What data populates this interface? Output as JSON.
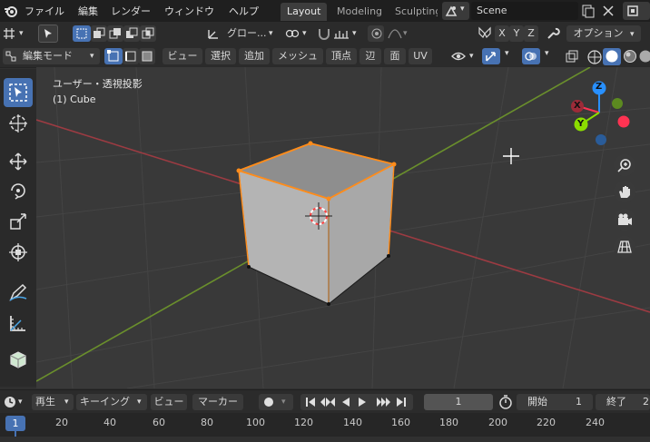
{
  "menubar": {
    "items": [
      "ファイル",
      "編集",
      "レンダー",
      "ウィンドウ",
      "ヘルプ"
    ],
    "workspace_tabs": [
      "Layout",
      "Modeling",
      "Sculpting"
    ],
    "active_tab": "Layout",
    "scene_name": "Scene"
  },
  "header1": {
    "transform_orientation": "グロー...",
    "axis_x": "X",
    "axis_y": "Y",
    "axis_z": "Z",
    "options": "オプション"
  },
  "header2": {
    "mode": "編集モード",
    "menus": [
      "ビュー",
      "選択",
      "追加",
      "メッシュ",
      "頂点",
      "辺",
      "面",
      "UV"
    ]
  },
  "viewport": {
    "view_label": "ユーザー・透視投影",
    "object_label": "(1) Cube",
    "gizmo": {
      "x": "X",
      "y": "Y",
      "z": "Z"
    }
  },
  "timeline": {
    "playback": "再生",
    "keying": "キーイング",
    "view": "ビュー",
    "marker": "マーカー",
    "current_frame": "1",
    "start_label": "開始",
    "start_value": "1",
    "end_label": "終了",
    "end_value": "2",
    "ruler_current": "1",
    "ruler_ticks": [
      "20",
      "40",
      "60",
      "80",
      "100",
      "120",
      "140",
      "160",
      "180",
      "200",
      "220",
      "240"
    ]
  },
  "colors": {
    "accent": "#4772b3",
    "x_axis": "#ff3352",
    "y_axis": "#8bdc00",
    "z_axis": "#2890ff",
    "selection": "#ff8c1a"
  }
}
